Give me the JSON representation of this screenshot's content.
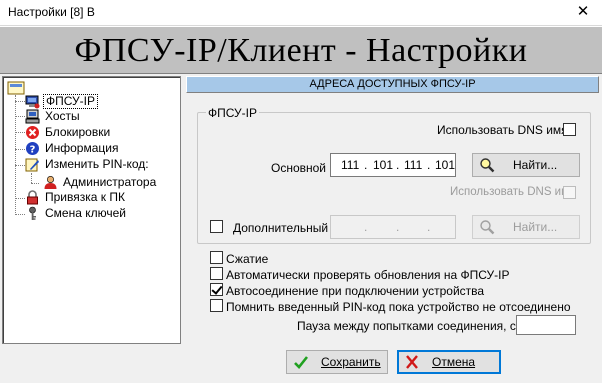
{
  "window": {
    "title": "Настройки [8] В",
    "close_glyph": "✕"
  },
  "header": {
    "title": "ФПСУ-IP/Клиент - Настройки"
  },
  "tree": {
    "items": [
      {
        "label": "ФПСУ-IP",
        "icon": "computer-icon",
        "selected": true
      },
      {
        "label": "Хосты",
        "icon": "hosts-icon"
      },
      {
        "label": "Блокировки",
        "icon": "block-icon"
      },
      {
        "label": "Информация",
        "icon": "info-icon"
      },
      {
        "label": "Изменить PIN-код:",
        "icon": "edit-pin-icon"
      },
      {
        "label": "Администратора",
        "icon": "admin-user-icon"
      },
      {
        "label": "Привязка к ПК",
        "icon": "lock-icon"
      },
      {
        "label": "Смена ключей",
        "icon": "key-icon"
      }
    ]
  },
  "panel": {
    "header": "АДРЕСА ДОСТУПНЫХ ФПСУ-IP",
    "group_title": "ФПСУ-IP",
    "use_dns_label": "Использовать DNS имя",
    "use_dns_checked": false,
    "primary": {
      "label": "Основной",
      "ip": [
        "111",
        "101",
        "111",
        "101"
      ],
      "find_label": "Найти..."
    },
    "use_dns2_label": "Использовать DNS имя",
    "secondary": {
      "label": "Дополнительный",
      "checked": false,
      "ip_dots": [
        ".",
        ".",
        "."
      ],
      "find_label": "Найти..."
    },
    "options": [
      {
        "label": "Сжатие",
        "checked": false
      },
      {
        "label": "Автоматически проверять обновления на ФПСУ-IP",
        "checked": false
      },
      {
        "label": "Автосоединение при подключении устройства",
        "checked": true
      },
      {
        "label": "Помнить введенный PIN-код пока устройство не отсоединено",
        "checked": false
      }
    ],
    "pause_label": "Пауза между попытками соединения, сек",
    "pause_value": ""
  },
  "footer": {
    "save_label": "Сохранить",
    "cancel_label": "Отмена"
  },
  "colors": {
    "panel_header_bg": "#a6c8e8",
    "header_bg": "#c0c0c0",
    "focus_border": "#0078d7"
  }
}
